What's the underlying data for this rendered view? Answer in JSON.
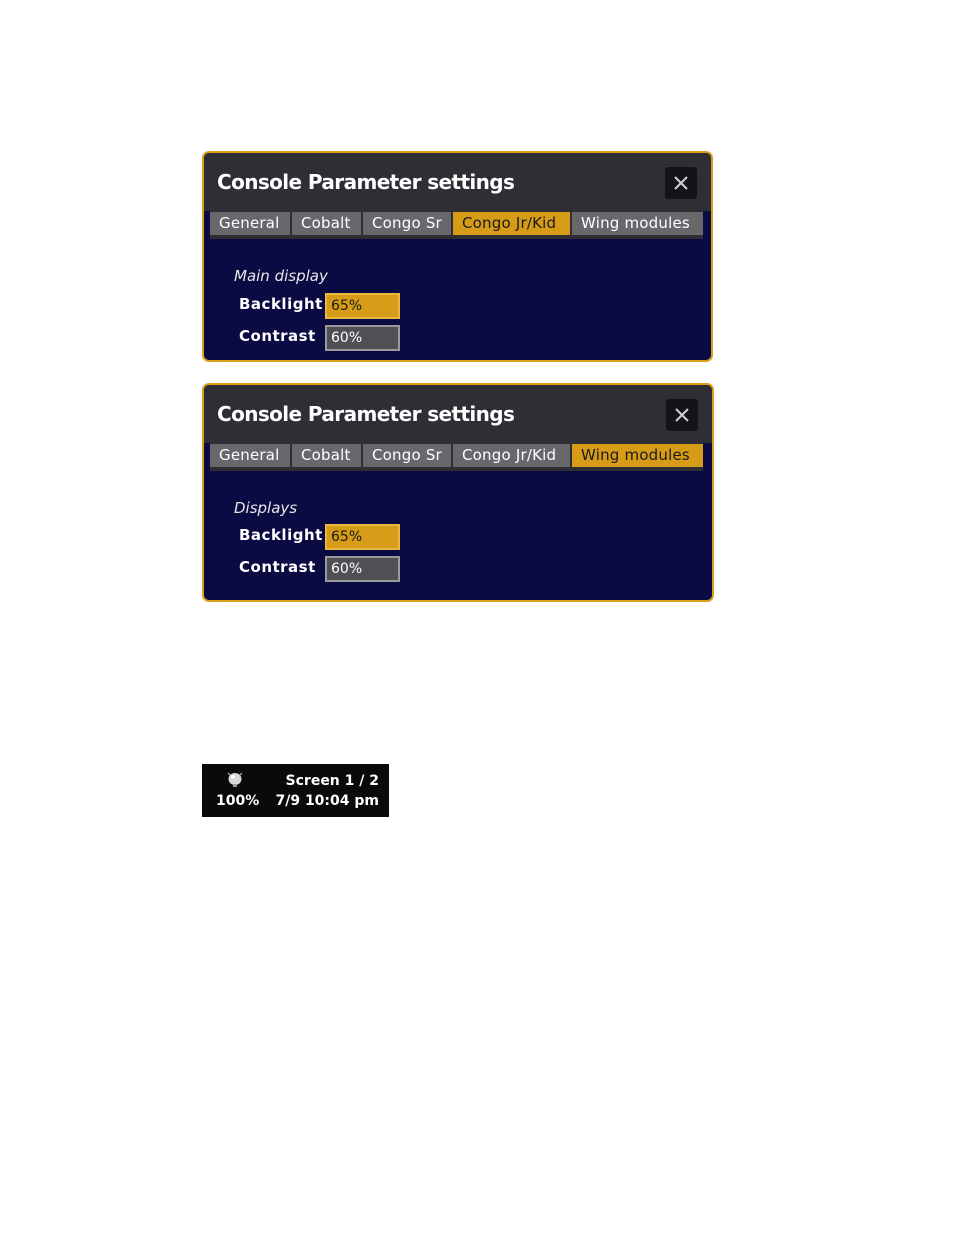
{
  "dialogs": [
    {
      "title": "Console Parameter settings",
      "tabs": [
        "General",
        "Cobalt",
        "Congo Sr",
        "Congo Jr/Kid",
        "Wing modules"
      ],
      "active_tab": "Congo Jr/Kid",
      "section_label": "Main display",
      "fields": [
        {
          "label": "Backlight",
          "value": "65%"
        },
        {
          "label": "Contrast",
          "value": "60%"
        }
      ]
    },
    {
      "title": "Console Parameter settings",
      "tabs": [
        "General",
        "Cobalt",
        "Congo Sr",
        "Congo Jr/Kid",
        "Wing modules"
      ],
      "active_tab": "Wing modules",
      "section_label": "Displays",
      "fields": [
        {
          "label": "Backlight",
          "value": "65%"
        },
        {
          "label": "Contrast",
          "value": "60%"
        }
      ]
    }
  ],
  "status_bar": {
    "brightness": "100%",
    "screen": "Screen 1 / 2",
    "datetime": "7/9 10:04 pm",
    "icon": "lightbulb-icon"
  },
  "colors": {
    "accent": "#d69c18",
    "panel_bg": "#0b0b44",
    "header_bg": "#2e2e34",
    "tab_bg": "#68686c"
  }
}
